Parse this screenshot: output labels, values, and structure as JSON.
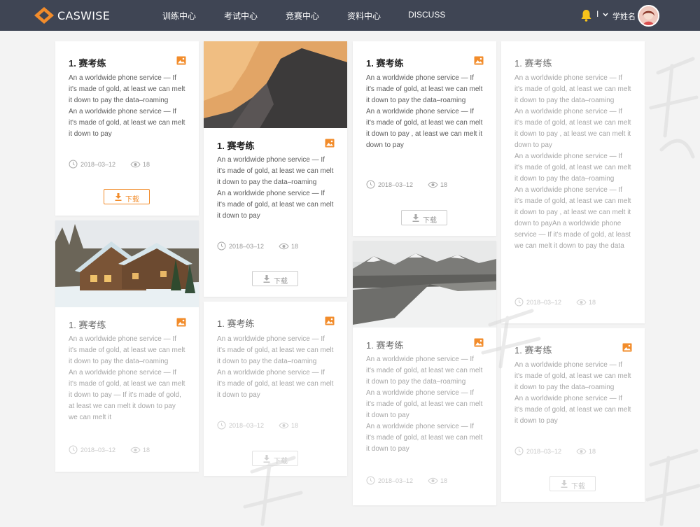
{
  "header": {
    "logo_text": "CASWISE",
    "nav": [
      "训练中心",
      "考试中心",
      "竞赛中心",
      "资料中心",
      "DISCUSS"
    ],
    "separator": "I",
    "username": "学姓名"
  },
  "cards": [
    {
      "title": "1.  赛考练",
      "paragraphs": [
        "An a worldwide phone service — If it's made of gold, at least we can melt it down to pay the data–roaming",
        "An a worldwide phone service — If it's made of gold, at least we can melt it down to pay"
      ],
      "date": "2018–03–12",
      "views": "18",
      "download": "下载"
    },
    {
      "title": "1.  赛考练",
      "paragraphs": [
        "An a worldwide phone service — If it's made of gold, at least we can melt it down to pay the data–roaming",
        "An a worldwide phone service — If it's made of gold, at least we can melt it down to pay"
      ],
      "date": "2018–03–12",
      "views": "18",
      "download": "下载"
    },
    {
      "title": "1.  赛考练",
      "paragraphs": [
        "An a worldwide phone service — If it's made of gold, at least we can melt it down to pay the data–roaming",
        "An a worldwide phone service — If it's made of gold, at least we can melt it down to pay , at least we can melt it down to pay"
      ],
      "date": "2018–03–12",
      "views": "18",
      "download": "下载"
    },
    {
      "title": "1.  赛考练",
      "paragraphs": [
        "An a worldwide phone service — If it's made of gold, at least we can melt it down to pay the data–roaming",
        "An a worldwide phone service — If it's made of gold, at least we can melt it down to pay , at least we can melt it down to pay",
        "An a worldwide phone service — If it's made of gold, at least we can melt it down to pay the data–roaming",
        "An a worldwide phone service — If it's made of gold, at least we can melt it down to pay , at least we can melt it down to payAn a worldwide phone service — If it's made of gold, at least we can melt it down to pay the data"
      ],
      "date": "2018–03–12",
      "views": "18"
    },
    {
      "title": "1.  赛考练",
      "paragraphs": [
        "An a worldwide phone service — If it's made of gold, at least we can melt it down to pay the data–roaming",
        "An a worldwide phone service — If it's made of gold, at least we can melt it down to pay — If it's made of gold, at least we can melt it down to pay we can melt it"
      ],
      "date": "2018–03–12",
      "views": "18"
    },
    {
      "title": "1.  赛考练",
      "paragraphs": [
        "An a worldwide phone service — If it's made of gold, at least we can melt it down to pay the data–roaming",
        "An a worldwide phone service — If it's made of gold, at least we can melt it down to pay"
      ],
      "date": "2018–03–12",
      "views": "18",
      "download": "下载"
    },
    {
      "title": "1.  赛考练",
      "paragraphs": [
        "An a worldwide phone service — If it's made of gold, at least we can melt it down to pay the data–roaming",
        "An a worldwide phone service — If it's made of gold, at least we can melt it down to pay",
        "An a worldwide phone service — If it's made of gold, at least we can melt it down to pay"
      ],
      "date": "2018–03–12",
      "views": "18"
    },
    {
      "title": "1.  赛考练",
      "paragraphs": [
        "An a worldwide phone service — If it's made of gold, at least we can melt it down to pay the data–roaming",
        "An a worldwide phone service — If it's made of gold, at least we can melt it down to pay"
      ],
      "date": "2018–03–12",
      "views": "18",
      "download": "下载"
    }
  ],
  "colors": {
    "header_bg": "#3f4554",
    "accent": "#f28c2b",
    "page_bg": "#f3f3f3"
  }
}
